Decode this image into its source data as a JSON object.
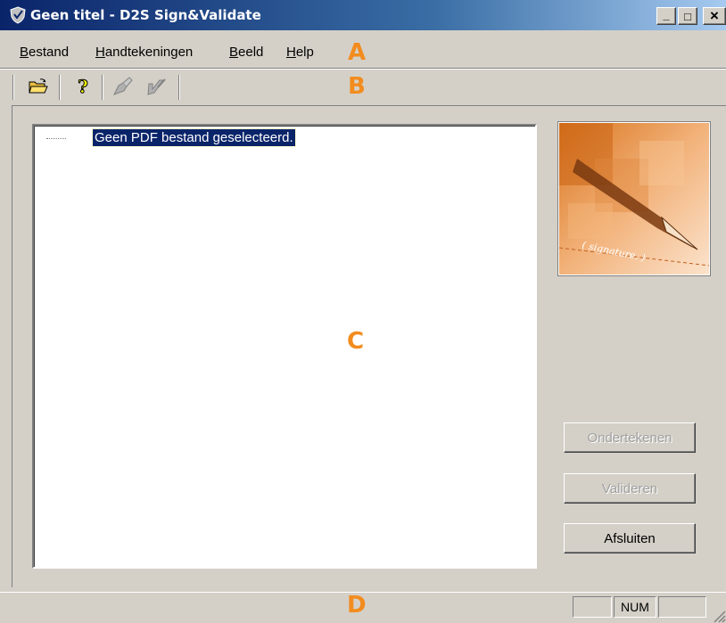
{
  "window": {
    "title": "Geen titel - D2S Sign&Validate",
    "controls": {
      "minimize": "_",
      "maximize": "□",
      "close": "×"
    }
  },
  "menu": {
    "items": [
      {
        "mnemonic": "B",
        "rest": "estand"
      },
      {
        "mnemonic": "H",
        "rest": "andtekeningen"
      },
      {
        "mnemonic": "B",
        "rest": "eeld"
      },
      {
        "mnemonic": "H",
        "rest": "elp"
      }
    ]
  },
  "toolbar": {
    "buttons": [
      {
        "icon": "open-folder-icon",
        "enabled": true
      },
      {
        "icon": "help-icon",
        "enabled": true
      },
      {
        "icon": "sign-pen-icon",
        "enabled": false
      },
      {
        "icon": "validate-pen-icon",
        "enabled": false
      }
    ]
  },
  "labels": {
    "a": "A",
    "b": "B",
    "c": "C",
    "d": "D"
  },
  "tree": {
    "selected_item": "Geen PDF bestand geselecteerd."
  },
  "image": {
    "caption": "( signature. )"
  },
  "buttons": {
    "sign": "Ondertekenen",
    "validate": "Valideren",
    "close": "Afsluiten"
  },
  "statusbar": {
    "panes": [
      "",
      "NUM",
      ""
    ]
  },
  "colors": {
    "titlebar_start": "#0a246a",
    "titlebar_end": "#a6caf0",
    "face": "#d4d0c8",
    "selection": "#0a246a",
    "overlay_label": "#f28c1e"
  }
}
